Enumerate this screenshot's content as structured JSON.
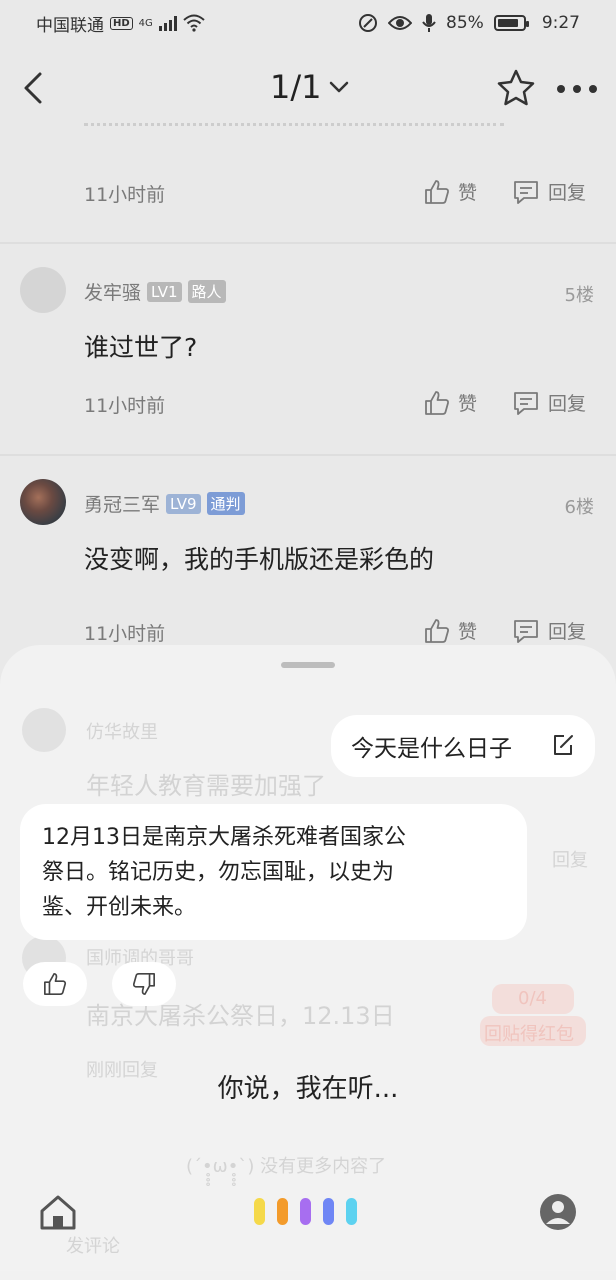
{
  "status": {
    "carrier": "中国联通",
    "hd": "HD",
    "network": "4G",
    "battery": "85%",
    "time": "9:27",
    "battery_level": 0.85
  },
  "header": {
    "page": "1/1"
  },
  "comments": [
    {
      "username": "",
      "content": "",
      "time": "11小时前",
      "like": "赞",
      "reply": "回复"
    },
    {
      "username": "发牢骚",
      "level": "LV1",
      "tag": "路人",
      "floor": "5楼",
      "content": "谁过世了?",
      "time": "11小时前",
      "like": "赞",
      "reply": "回复"
    },
    {
      "username": "勇冠三军",
      "level": "LV9",
      "tag": "通判",
      "floor": "6楼",
      "content": "没变啊，我的手机版还是彩色的",
      "time": "11小时前",
      "like": "赞",
      "reply": "回复"
    }
  ],
  "background": {
    "c4_user": "仿华故里",
    "c4_content": "年轻人教育需要加强了",
    "c4_reply": "回复",
    "c5_user": "国师调的哥哥",
    "c5_content": "南京大屠杀公祭日，12.13日",
    "c5_time": "刚刚回复",
    "c5_badge1": "0/4",
    "c5_badge2": "回贴得红包",
    "end_text": "(´•̥̥̥ω•̥̥̥`) 没有更多内容了",
    "comment_placeholder": "发评论"
  },
  "assistant": {
    "user_query": "今天是什么日子",
    "answer_line1": "12月13日是南京大屠杀死难者国家公",
    "answer_line2": "祭日。铭记历史，勿忘国耻，以史为",
    "answer_line3": "鉴、开创未来。",
    "listening": "你说，我在听..."
  },
  "colors": {
    "wave": [
      "#f5d94a",
      "#f39b2b",
      "#a76ef0",
      "#6f86f5",
      "#5dd2f0"
    ]
  }
}
